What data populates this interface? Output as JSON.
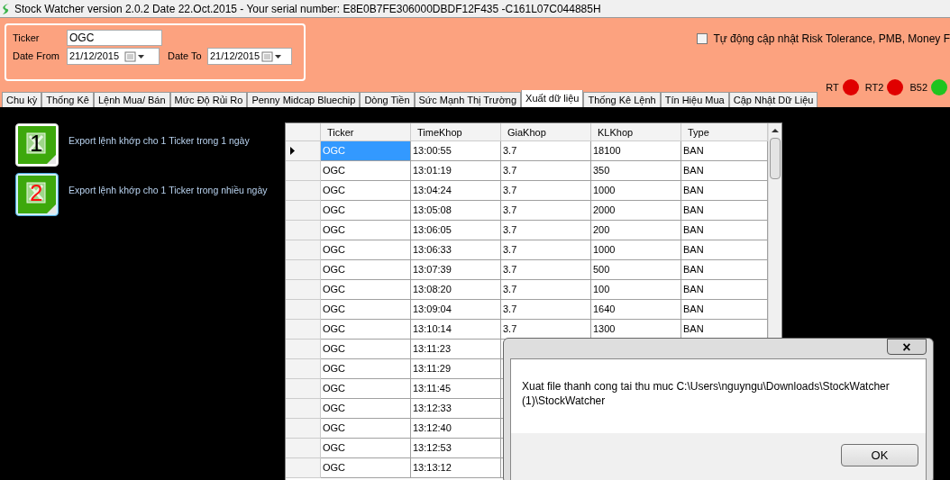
{
  "window": {
    "title": "Stock Watcher version 2.0.2 Date 22.Oct.2015 - Your serial number: E8E0B7FE306000DBDF12F435 -C161L07C044885H"
  },
  "filters": {
    "ticker_label": "Ticker",
    "ticker": "OGC",
    "date_from_label": "Date From",
    "date_from": "21/12/2015",
    "date_to_label": "Date To",
    "date_to": "21/12/2015"
  },
  "auto_update": {
    "label": "Tự động cập nhật Risk Tolerance, PMB, Money F",
    "checked": false
  },
  "tabs": [
    {
      "label": "Chu kỳ",
      "selected": false
    },
    {
      "label": "Thống Kê",
      "selected": false
    },
    {
      "label": "Lệnh Mua/ Bán",
      "selected": false
    },
    {
      "label": "Mức Độ Rủi Ro",
      "selected": false
    },
    {
      "label": "Penny Midcap Bluechip",
      "selected": false
    },
    {
      "label": "Dòng Tiền",
      "selected": false
    },
    {
      "label": "Sức Mạnh Thị Trường",
      "selected": false
    },
    {
      "label": "Xuất dữ liệu",
      "selected": true
    },
    {
      "label": "Thống Kê Lệnh",
      "selected": false
    },
    {
      "label": "Tín Hiệu Mua",
      "selected": false
    },
    {
      "label": "Cập Nhật Dữ Liệu",
      "selected": false
    }
  ],
  "indicators": [
    {
      "label": "RT",
      "color": "#e00000"
    },
    {
      "label": "RT2",
      "color": "#e00000"
    },
    {
      "label": "B52",
      "color": "#1fc41f"
    }
  ],
  "exports": [
    {
      "number": "1",
      "label": "Export lệnh khớp cho 1 Ticker trong 1 ngày",
      "selected": false
    },
    {
      "number": "2",
      "label": "Export lệnh khớp cho 1 Ticker trong nhiều ngày",
      "selected": true
    }
  ],
  "table": {
    "columns": [
      "Ticker",
      "TimeKhop",
      "GiaKhop",
      "KLKhop",
      "Type"
    ],
    "rows": [
      {
        "cells": [
          "OGC",
          "13:00:55",
          "3.7",
          "18100",
          "BAN"
        ],
        "selected": true
      },
      {
        "cells": [
          "OGC",
          "13:01:19",
          "3.7",
          "350",
          "BAN"
        ],
        "selected": false
      },
      {
        "cells": [
          "OGC",
          "13:04:24",
          "3.7",
          "1000",
          "BAN"
        ],
        "selected": false
      },
      {
        "cells": [
          "OGC",
          "13:05:08",
          "3.7",
          "2000",
          "BAN"
        ],
        "selected": false
      },
      {
        "cells": [
          "OGC",
          "13:06:05",
          "3.7",
          "200",
          "BAN"
        ],
        "selected": false
      },
      {
        "cells": [
          "OGC",
          "13:06:33",
          "3.7",
          "1000",
          "BAN"
        ],
        "selected": false
      },
      {
        "cells": [
          "OGC",
          "13:07:39",
          "3.7",
          "500",
          "BAN"
        ],
        "selected": false
      },
      {
        "cells": [
          "OGC",
          "13:08:20",
          "3.7",
          "100",
          "BAN"
        ],
        "selected": false
      },
      {
        "cells": [
          "OGC",
          "13:09:04",
          "3.7",
          "1640",
          "BAN"
        ],
        "selected": false
      },
      {
        "cells": [
          "OGC",
          "13:10:14",
          "3.7",
          "1300",
          "BAN"
        ],
        "selected": false
      },
      {
        "cells": [
          "OGC",
          "13:11:23"
        ],
        "selected": false
      },
      {
        "cells": [
          "OGC",
          "13:11:29"
        ],
        "selected": false
      },
      {
        "cells": [
          "OGC",
          "13:11:45"
        ],
        "selected": false
      },
      {
        "cells": [
          "OGC",
          "13:12:33"
        ],
        "selected": false
      },
      {
        "cells": [
          "OGC",
          "13:12:40"
        ],
        "selected": false
      },
      {
        "cells": [
          "OGC",
          "13:12:53"
        ],
        "selected": false
      },
      {
        "cells": [
          "OGC",
          "13:13:12"
        ],
        "selected": false
      }
    ]
  },
  "dialog": {
    "message": "Xuat file thanh cong tai thu muc C:\\Users\\nguyngu\\Downloads\\StockWatcher (1)\\StockWatcher",
    "close": "×",
    "button": "OK"
  }
}
